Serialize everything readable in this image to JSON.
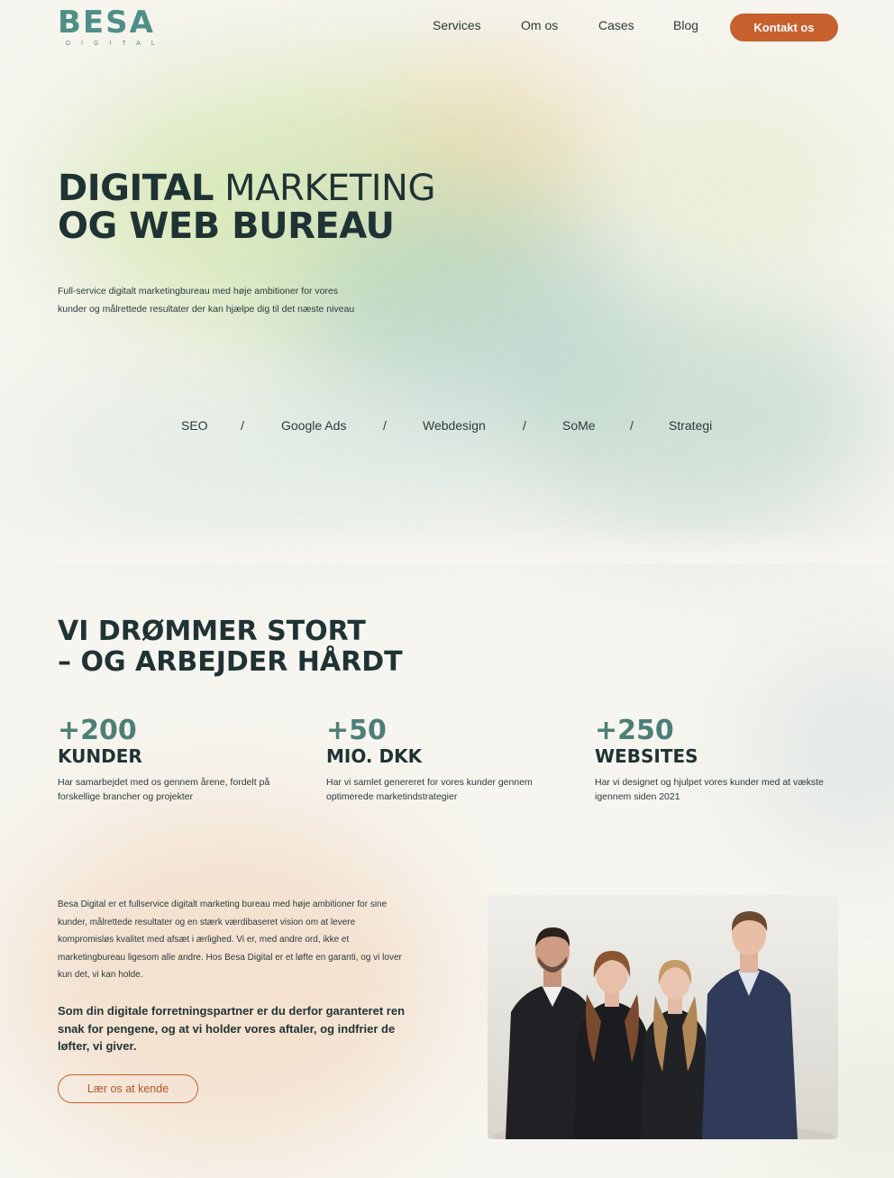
{
  "header": {
    "logo_text": "BESA",
    "logo_sub": "DIGITAL",
    "nav": [
      "Services",
      "Om os",
      "Cases",
      "Blog"
    ],
    "cta_label": "Kontakt os"
  },
  "hero": {
    "title_line1_bold": "DIGITAL",
    "title_line1_light": " MARKETING",
    "title_line2": "OG WEB BUREAU",
    "description": "Full-service digitalt marketingbureau med høje ambitioner for vores kunder og målrettede resultater der kan hjælpe dig til det næste niveau",
    "services": [
      "SEO",
      "Google Ads",
      "Webdesign",
      "SoMe",
      "Strategi"
    ],
    "separator": "/"
  },
  "stats": {
    "title_line1": "VI DRØMMER STORT",
    "title_line2": "– OG ARBEJDER HÅRDT",
    "items": [
      {
        "number": "+200",
        "label": "KUNDER",
        "description": "Har samarbejdet med os gennem årene, fordelt på forskellige brancher og projekter"
      },
      {
        "number": "+50",
        "label": "MIO. DKK",
        "description": "Har vi samlet genereret for vores kunder gennem optimerede marketindstrategier"
      },
      {
        "number": "+250",
        "label": "WEBSITES",
        "description": "Har vi designet og hjulpet vores kunder med at vækste igennem siden 2021"
      }
    ]
  },
  "about": {
    "text": "Besa Digital er et fullservice digitalt marketing bureau med høje ambitioner for sine kunder, målrettede resultater og en stærk værdibaseret vision om at levere kompromisløs kvalitet med afsæt i ærlighed. Vi er, med andre ord, ikke et marketingbureau ligesom alle andre. Hos Besa Digital er et løfte en garanti, og vi lover kun det, vi kan holde.",
    "bold_text": "Som din digitale forretningspartner er du derfor garanteret ren snak for pengene, og at vi holder vores aftaler, og indfrier de løfter, vi giver.",
    "button_label": "Lær os at kende"
  },
  "colors": {
    "brand_teal": "#4f8f86",
    "accent_orange": "#c8602e",
    "text_dark": "#1f3334",
    "background": "#f6f5ef"
  }
}
